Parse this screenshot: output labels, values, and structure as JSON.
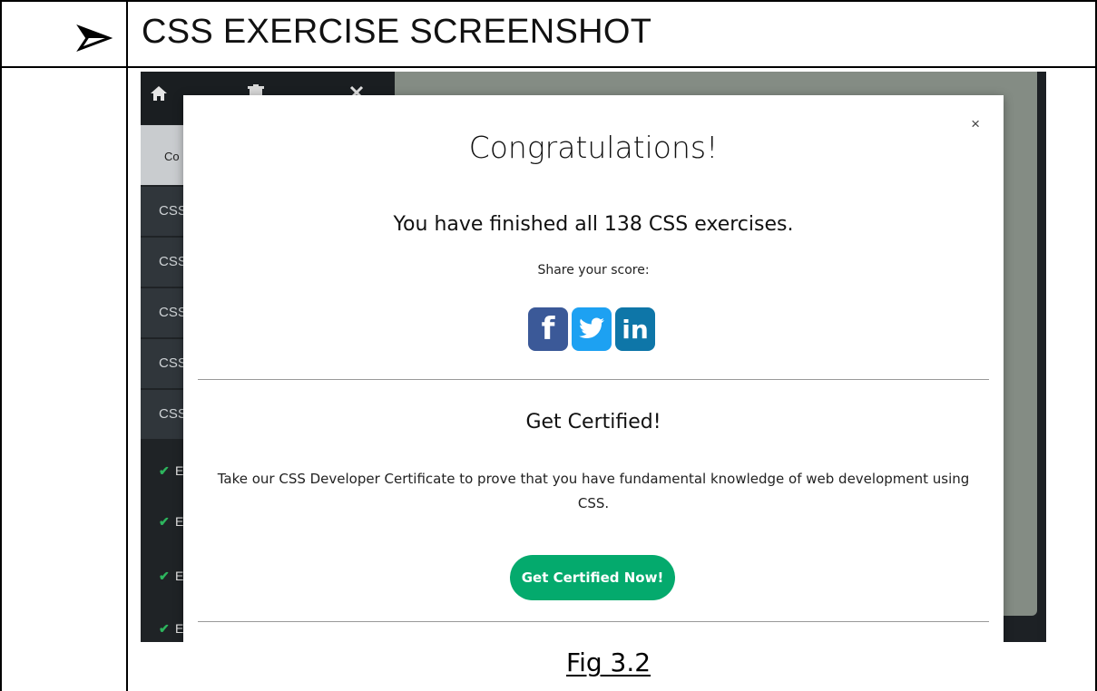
{
  "document": {
    "section_title": "CSS EXERCISE SCREENSHOT",
    "figure_caption": "Fig 3.2"
  },
  "sidebar": {
    "course_button_label": "Co",
    "items": [
      "CSS",
      "CSS",
      "CSS",
      "CSS",
      "CSS"
    ],
    "exercises": [
      "E",
      "E",
      "E",
      "E"
    ]
  },
  "modal": {
    "close_label": "×",
    "title": "Congratulations!",
    "finished_text": "You have finished all 138 CSS exercises.",
    "share_label": "Share your score:",
    "certified_heading": "Get Certified!",
    "certificate_description": "Take our CSS Developer Certificate to prove that you have fundamental knowledge of web development using CSS.",
    "cta_label": "Get Certified Now!",
    "social": {
      "facebook": {
        "icon": "facebook-icon",
        "glyph": "f",
        "color": "#3b5998"
      },
      "twitter": {
        "icon": "twitter-icon",
        "color": "#1da1f2"
      },
      "linkedin": {
        "icon": "linkedin-icon",
        "glyph": "in",
        "color": "#0e76a8"
      }
    },
    "cta_color": "#04aa6d"
  },
  "colors": {
    "sidebar_bg": "#1f2326",
    "main_bg": "#848c84"
  }
}
